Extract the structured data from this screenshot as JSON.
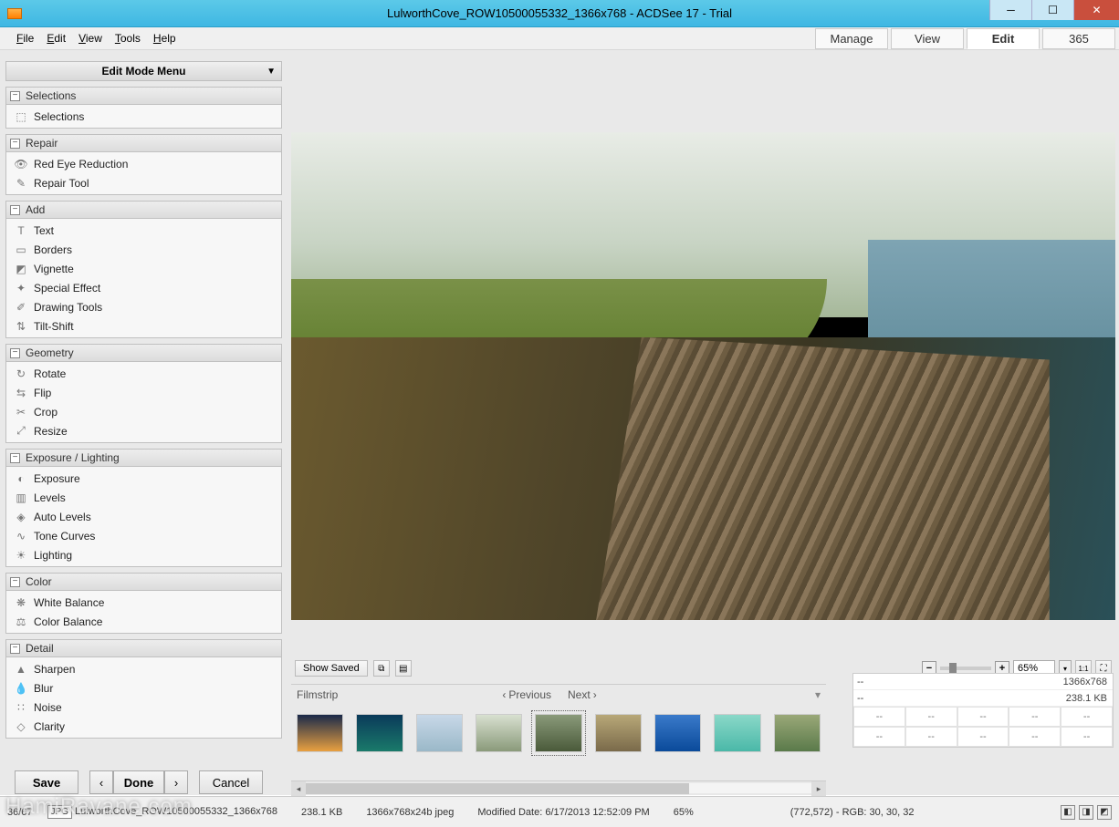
{
  "title": "LulworthCove_ROW10500055332_1366x768 - ACDSee 17 - Trial",
  "menubar": [
    "File",
    "Edit",
    "View",
    "Tools",
    "Help"
  ],
  "mode_tabs": {
    "items": [
      "Manage",
      "View",
      "Edit",
      "365"
    ],
    "active": "Edit"
  },
  "edit_mode_menu_label": "Edit Mode Menu",
  "groups": [
    {
      "name": "Selections",
      "items": [
        "Selections"
      ]
    },
    {
      "name": "Repair",
      "items": [
        "Red Eye Reduction",
        "Repair Tool"
      ]
    },
    {
      "name": "Add",
      "items": [
        "Text",
        "Borders",
        "Vignette",
        "Special Effect",
        "Drawing Tools",
        "Tilt-Shift"
      ]
    },
    {
      "name": "Geometry",
      "items": [
        "Rotate",
        "Flip",
        "Crop",
        "Resize"
      ]
    },
    {
      "name": "Exposure / Lighting",
      "items": [
        "Exposure",
        "Levels",
        "Auto Levels",
        "Tone Curves",
        "Lighting"
      ]
    },
    {
      "name": "Color",
      "items": [
        "White Balance",
        "Color Balance"
      ]
    },
    {
      "name": "Detail",
      "items": [
        "Sharpen",
        "Blur",
        "Noise",
        "Clarity"
      ]
    }
  ],
  "buttons": {
    "save": "Save",
    "done": "Done",
    "cancel": "Cancel"
  },
  "film_controls": {
    "show_saved": "Show Saved",
    "zoom_pct": "65%"
  },
  "filmstrip": {
    "label": "Filmstrip",
    "prev": "Previous",
    "next": "Next"
  },
  "info": {
    "row1_left": "--",
    "row1_right": "1366x768",
    "row2_left": "--",
    "row2_right": "238.1 KB",
    "cell": "--"
  },
  "status": {
    "counter": "36/67",
    "filename_prefix": "JPG",
    "filename": "LulworthCove_ROW10500055332_1366x768",
    "size": "238.1 KB",
    "format": "1366x768x24b jpeg",
    "modified": "Modified Date: 6/17/2013 12:52:09 PM",
    "zoom": "65%",
    "cursor": "(772,572) - RGB: 30, 30, 32"
  },
  "watermark": "HamiRavane.com",
  "thumb_colors": [
    "linear-gradient(#1a2a4a,#e8a040)",
    "linear-gradient(#0a3a5a,#1a7a6a)",
    "linear-gradient(#c8d8e8,#9ab8c8)",
    "linear-gradient(#d8e0d0,#8a9a7a)",
    "linear-gradient(#8a9a7a,#4a5a3a)",
    "linear-gradient(#b8a878,#7a6a4a)",
    "linear-gradient(#3a7aca,#0a4a9a)",
    "linear-gradient(#8ad8c8,#4ab8a8)",
    "linear-gradient(#9aa878,#5a7a4a)"
  ],
  "item_icons": {
    "Selections": "⬚",
    "Red Eye Reduction": "👁",
    "Repair Tool": "✎",
    "Text": "T",
    "Borders": "▭",
    "Vignette": "◩",
    "Special Effect": "✦",
    "Drawing Tools": "✐",
    "Tilt-Shift": "⇅",
    "Rotate": "↻",
    "Flip": "⇆",
    "Crop": "✂",
    "Resize": "⤢",
    "Exposure": "◐",
    "Levels": "▥",
    "Auto Levels": "◈",
    "Tone Curves": "∿",
    "Lighting": "☀",
    "White Balance": "❋",
    "Color Balance": "⚖",
    "Sharpen": "▲",
    "Blur": "💧",
    "Noise": "∷",
    "Clarity": "◇"
  }
}
